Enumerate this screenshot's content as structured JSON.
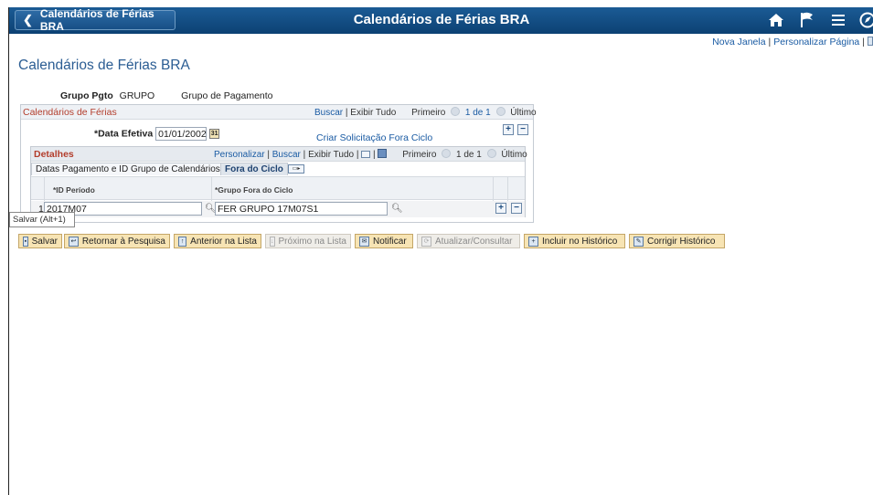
{
  "topbar": {
    "back_label": "Calendários de Férias BRA",
    "heading": "Calendários de Férias BRA"
  },
  "toplinks": {
    "new_window": "Nova Janela",
    "personalize": "Personalizar Página"
  },
  "page": {
    "title": "Calendários de Férias BRA",
    "grupo_label": "Grupo Pgto",
    "grupo_value": "GRUPO",
    "grupo_desc": "Grupo de Pagamento"
  },
  "calendarios": {
    "title": "Calendários de Férias",
    "buscar": "Buscar",
    "exibir": "Exibir Tudo",
    "primeiro": "Primeiro",
    "count": "1 de 1",
    "ultimo": "Último",
    "effdate_label": "*Data Efetiva",
    "effdate_value": "01/01/2002",
    "criar": "Criar Solicitação Fora Ciclo"
  },
  "detalhes": {
    "title": "Detalhes",
    "personalizar": "Personalizar",
    "buscar": "Buscar",
    "exibir": "Exibir Tudo",
    "primeiro": "Primeiro",
    "count": "1 de 1",
    "ultimo": "Último",
    "tab1": "Datas Pagamento e ID Grupo de Calendários",
    "tab2": "Fora do Ciclo",
    "col1": "*ID Período",
    "col2": "*Grupo Fora do Ciclo",
    "row_num": "1",
    "periodo_value": "2017M07",
    "grupo_value": "FER GRUPO 17M07S1"
  },
  "tooltip": "Salvar (Alt+1)",
  "toolbar": {
    "salvar": "Salvar",
    "retornar": "Retornar à Pesquisa",
    "anterior": "Anterior na Lista",
    "proximo": "Próximo na Lista",
    "notificar": "Notificar",
    "atualizar": "Atualizar/Consultar",
    "incluir": "Incluir no Histórico",
    "corrigir": "Corrigir Histórico"
  }
}
